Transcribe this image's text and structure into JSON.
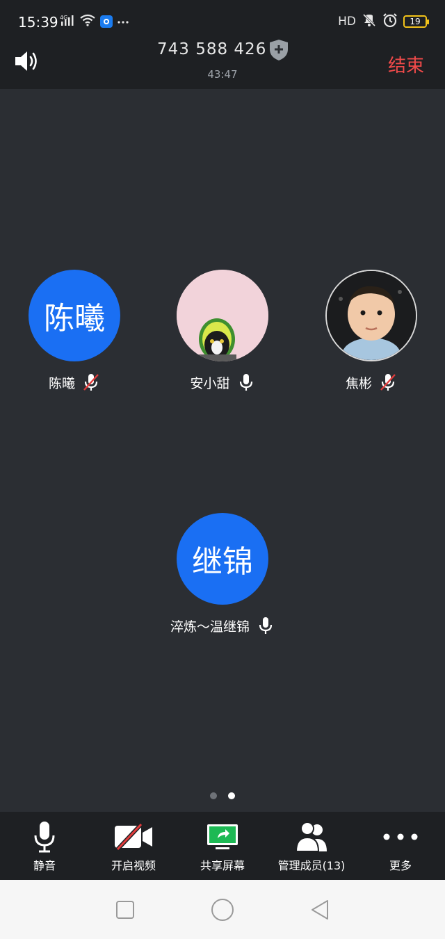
{
  "status_bar": {
    "time": "15:39",
    "network": "4G",
    "hd": "HD",
    "battery": "19"
  },
  "header": {
    "meeting_id": "743 588 426",
    "timer": "43:47",
    "end_label": "结束"
  },
  "participants": [
    {
      "avatar_text": "陈曦",
      "name": "陈曦",
      "mic": "muted"
    },
    {
      "avatar_text": "",
      "name": "安小甜",
      "mic": "on"
    },
    {
      "avatar_text": "",
      "name": "焦彬",
      "mic": "muted"
    },
    {
      "avatar_text": "继锦",
      "name": "淬炼～温继锦",
      "mic": "on"
    }
  ],
  "pager": {
    "pages": 2,
    "current": 2
  },
  "toolbar": {
    "mute_label": "静音",
    "video_label": "开启视频",
    "share_label": "共享屏幕",
    "members_label": "管理成员(13)",
    "more_label": "更多"
  },
  "colors": {
    "background": "#2b2e33",
    "bar": "#1e2023",
    "avatar_blue": "#1a6ff3",
    "end_red": "#f04a4a",
    "share_green": "#1db954"
  }
}
